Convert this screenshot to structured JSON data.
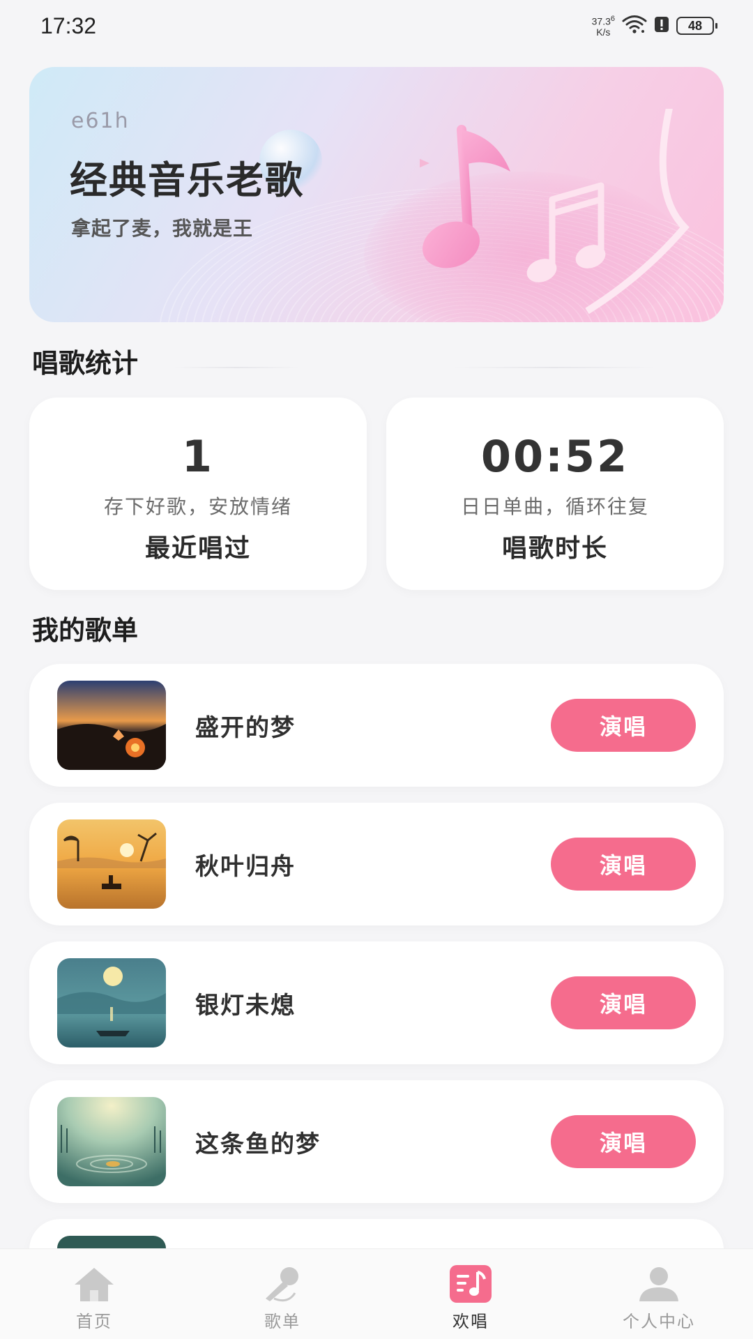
{
  "status_bar": {
    "time": "17:32",
    "net_speed": "37.3",
    "net_unit": "K/s",
    "net_sup": "6",
    "battery": "48"
  },
  "banner": {
    "label": "e61h",
    "title": "经典音乐老歌",
    "subtitle": "拿起了麦，我就是王"
  },
  "stats_section": {
    "title": "唱歌统计",
    "cards": [
      {
        "value": "1",
        "description": "存下好歌，安放情绪",
        "label": "最近唱过"
      },
      {
        "value": "00:52",
        "description": "日日单曲，循环往复",
        "label": "唱歌时长"
      }
    ]
  },
  "songs_section": {
    "title": "我的歌单",
    "button_label": "演唱",
    "songs": [
      {
        "name": "盛开的梦"
      },
      {
        "name": "秋叶归舟"
      },
      {
        "name": "银灯未熄"
      },
      {
        "name": "这条鱼的梦"
      }
    ]
  },
  "bottom_nav": {
    "items": [
      {
        "label": "首页",
        "icon": "home-icon"
      },
      {
        "label": "歌单",
        "icon": "microphone-icon"
      },
      {
        "label": "欢唱",
        "icon": "music-list-icon",
        "active": true
      },
      {
        "label": "个人中心",
        "icon": "person-icon"
      }
    ]
  },
  "colors": {
    "accent": "#f56c8d",
    "background": "#f5f5f7",
    "card": "#ffffff"
  }
}
